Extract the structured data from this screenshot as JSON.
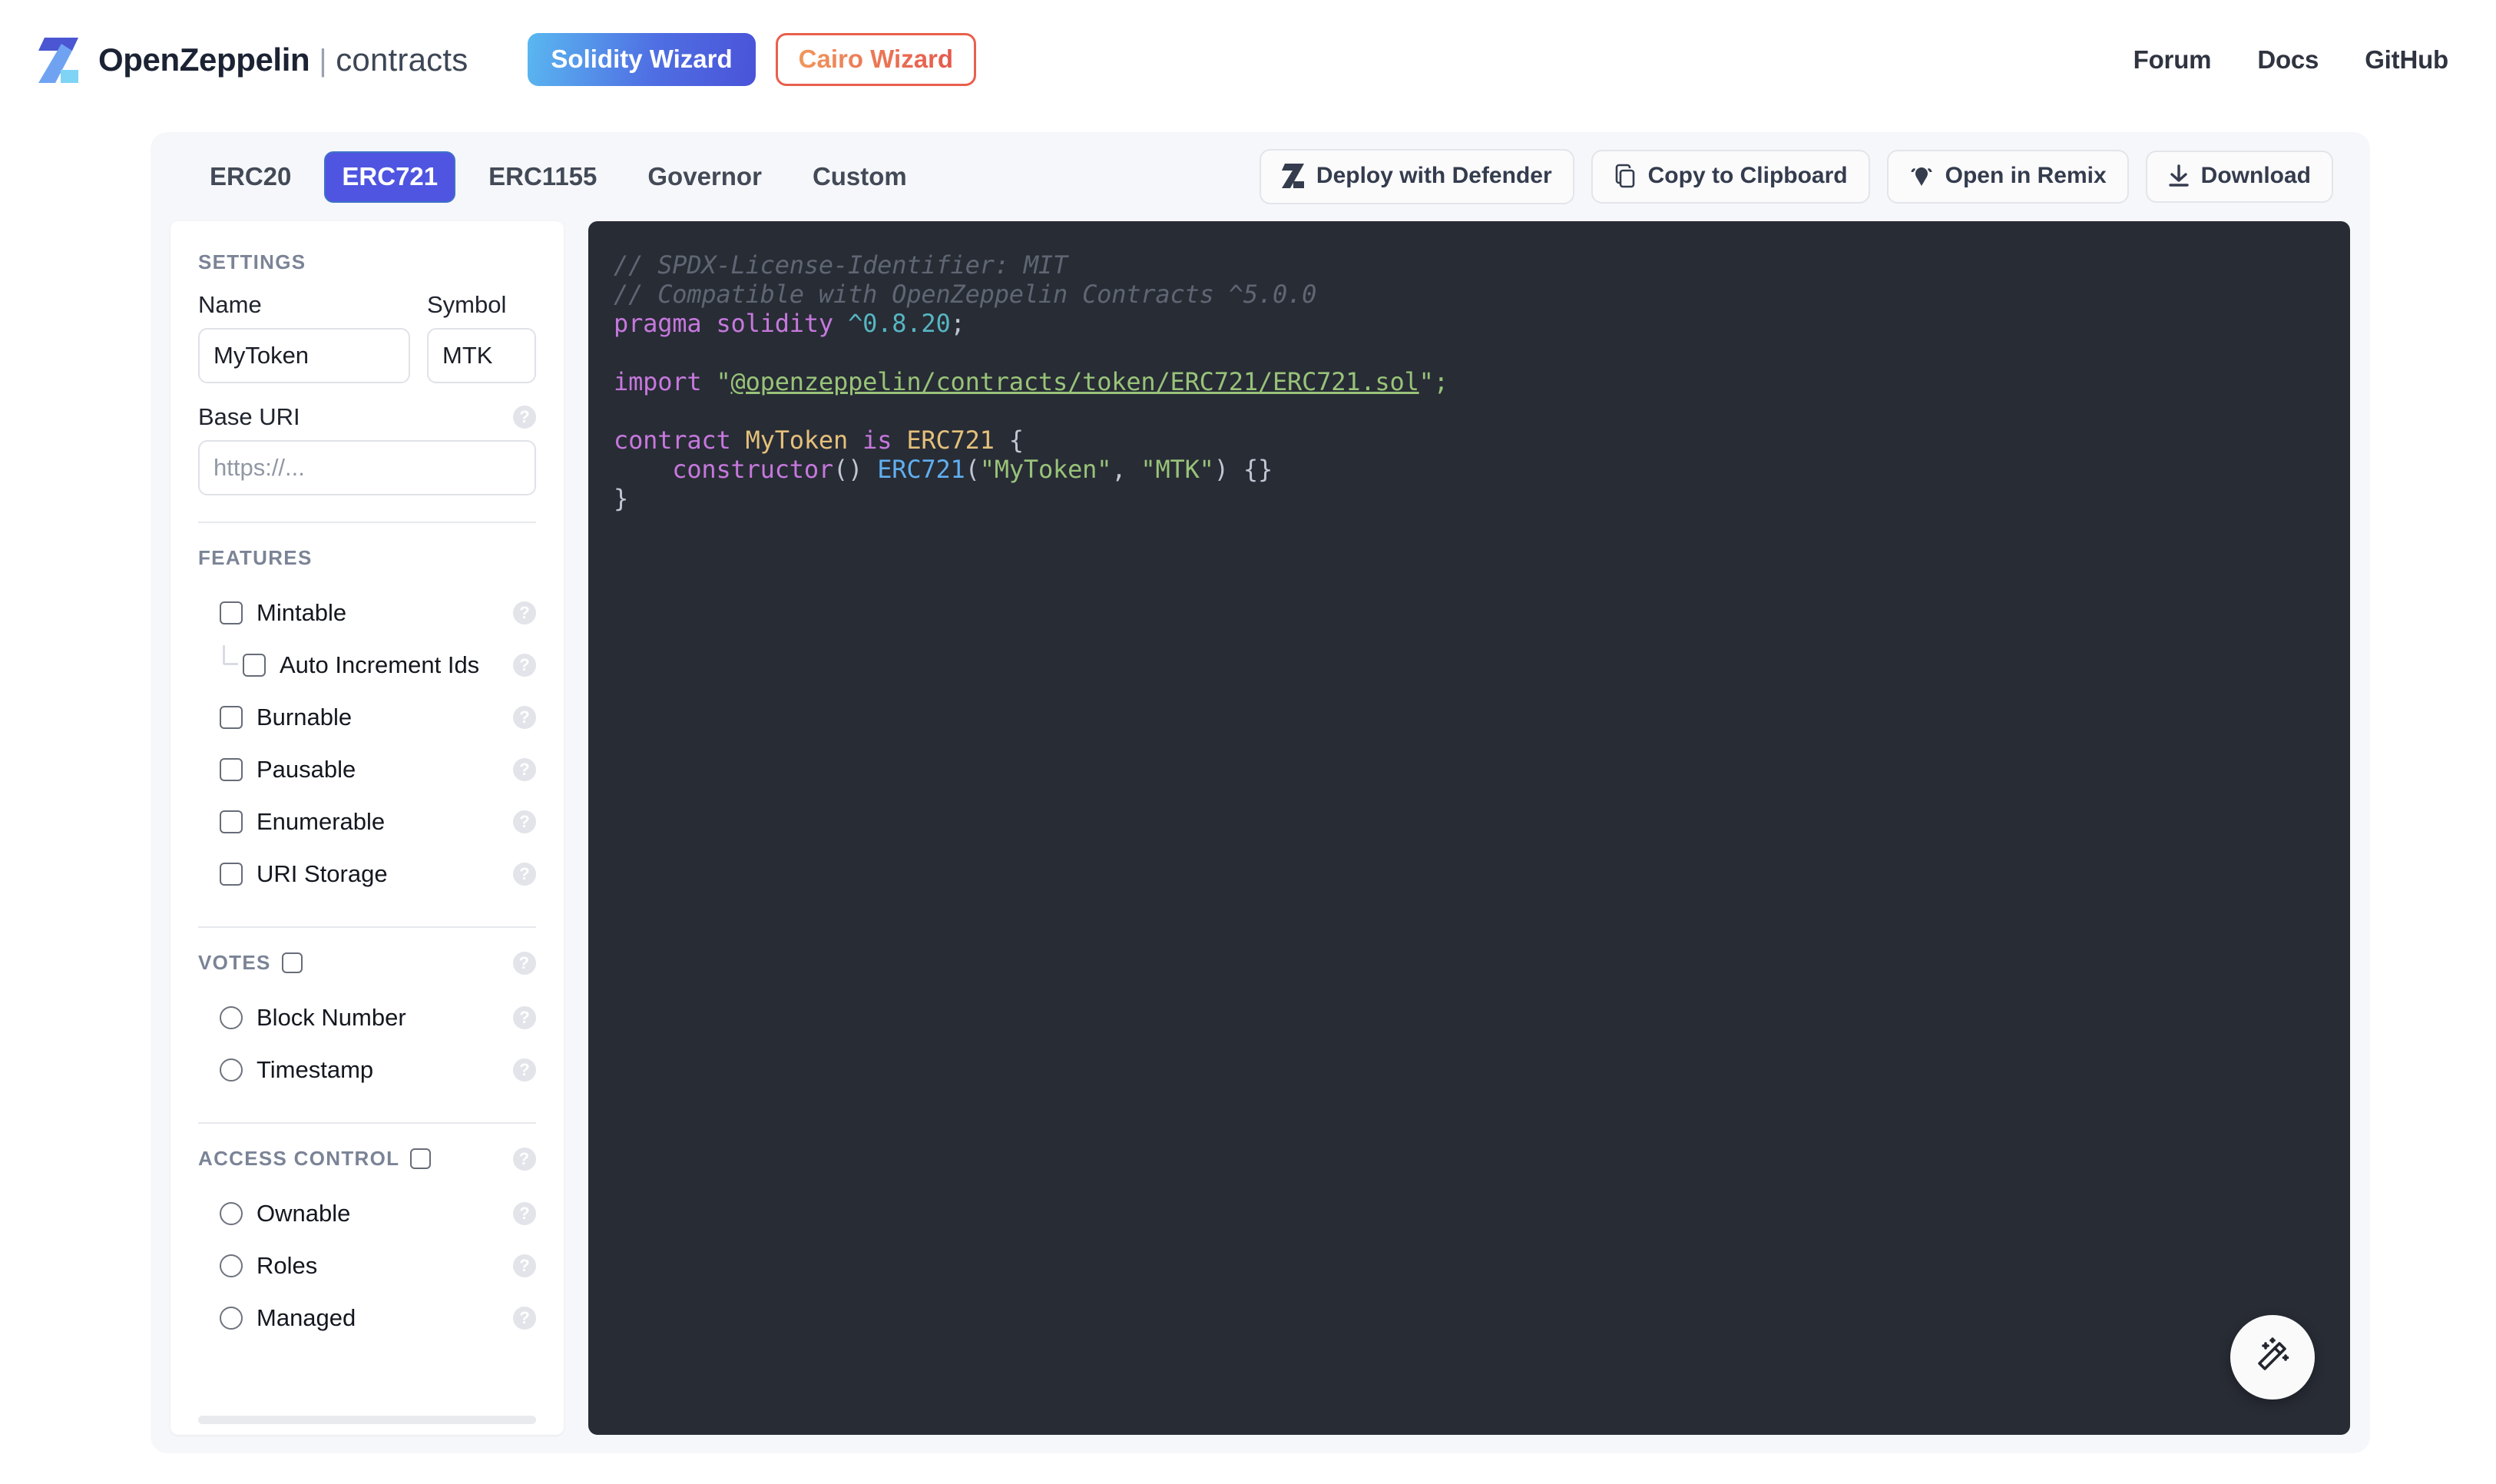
{
  "header": {
    "logo_icon": "openzeppelin-z-logo",
    "brand_name": "OpenZeppelin",
    "brand_separator": "|",
    "brand_sub": "contracts",
    "solidity_wizard_label": "Solidity Wizard",
    "cairo_wizard_label": "Cairo Wizard",
    "links": [
      {
        "label": "Forum"
      },
      {
        "label": "Docs"
      },
      {
        "label": "GitHub"
      }
    ],
    "colors": {
      "solidity_gradient_from": "#5ab8f0",
      "solidity_gradient_to": "#4a53d8",
      "cairo_border": "#e8604c",
      "cairo_gradient_from": "#f0975c",
      "cairo_gradient_to": "#e4594c"
    }
  },
  "toolbar": {
    "tabs": [
      {
        "label": "ERC20",
        "active": false
      },
      {
        "label": "ERC721",
        "active": true
      },
      {
        "label": "ERC1155",
        "active": false
      },
      {
        "label": "Governor",
        "active": false
      },
      {
        "label": "Custom",
        "active": false
      }
    ],
    "active_tab": "ERC721",
    "active_tab_color": "#4f55e0",
    "actions": [
      {
        "label": "Deploy with Defender",
        "icon": "openzeppelin-z-icon"
      },
      {
        "label": "Copy to Clipboard",
        "icon": "copy-icon"
      },
      {
        "label": "Open in Remix",
        "icon": "remix-icon"
      },
      {
        "label": "Download",
        "icon": "download-icon"
      }
    ]
  },
  "sidebar": {
    "settings": {
      "title": "SETTINGS",
      "name_label": "Name",
      "name_value": "MyToken",
      "symbol_label": "Symbol",
      "symbol_value": "MTK",
      "base_uri_label": "Base URI",
      "base_uri_value": "",
      "base_uri_placeholder": "https://..."
    },
    "features": {
      "title": "FEATURES",
      "items": [
        {
          "label": "Mintable",
          "type": "checkbox",
          "checked": false,
          "nested": false
        },
        {
          "label": "Auto Increment Ids",
          "type": "checkbox",
          "checked": false,
          "nested": true
        },
        {
          "label": "Burnable",
          "type": "checkbox",
          "checked": false,
          "nested": false
        },
        {
          "label": "Pausable",
          "type": "checkbox",
          "checked": false,
          "nested": false
        },
        {
          "label": "Enumerable",
          "type": "checkbox",
          "checked": false,
          "nested": false
        },
        {
          "label": "URI Storage",
          "type": "checkbox",
          "checked": false,
          "nested": false
        }
      ]
    },
    "votes": {
      "title": "VOTES",
      "checked": false,
      "items": [
        {
          "label": "Block Number",
          "type": "radio",
          "checked": false
        },
        {
          "label": "Timestamp",
          "type": "radio",
          "checked": false
        }
      ]
    },
    "access_control": {
      "title": "ACCESS CONTROL",
      "checked": false,
      "items": [
        {
          "label": "Ownable",
          "type": "radio",
          "checked": false
        },
        {
          "label": "Roles",
          "type": "radio",
          "checked": false
        },
        {
          "label": "Managed",
          "type": "radio",
          "checked": false
        }
      ]
    },
    "help_glyph": "?"
  },
  "editor": {
    "language": "solidity",
    "background": "#282c35",
    "lines": [
      "// SPDX-License-Identifier: MIT",
      "// Compatible with OpenZeppelin Contracts ^5.0.0",
      "pragma solidity ^0.8.20;",
      "",
      "import \"@openzeppelin/contracts/token/ERC721/ERC721.sol\";",
      "",
      "contract MyToken is ERC721 {",
      "    constructor() ERC721(\"MyToken\", \"MTK\") {}",
      "}"
    ],
    "tokens": {
      "comment_1": "// SPDX-License-Identifier: MIT",
      "comment_2": "// Compatible with OpenZeppelin Contracts ^5.0.0",
      "kw_pragma": "pragma solidity ",
      "num_version": "^0.8.20",
      "semicolon": ";",
      "kw_import": "import ",
      "import_quote_open": "\"",
      "import_path": "@openzeppelin/contracts/token/ERC721/ERC721.sol",
      "import_quote_close": "\";",
      "kw_contract": "contract ",
      "contract_name": "MyToken",
      "kw_is": " is ",
      "base_contract": "ERC721",
      "brace_open": " {",
      "kw_constructor": "    constructor",
      "ctor_parens": "() ",
      "ctor_call": "ERC721",
      "ctor_paren_open": "(",
      "ctor_arg1": "\"MyToken\"",
      "ctor_comma": ", ",
      "ctor_arg2": "\"MTK\"",
      "ctor_paren_close": ") {}",
      "brace_close": "}"
    },
    "fab_icon": "magic-wand-icon"
  }
}
